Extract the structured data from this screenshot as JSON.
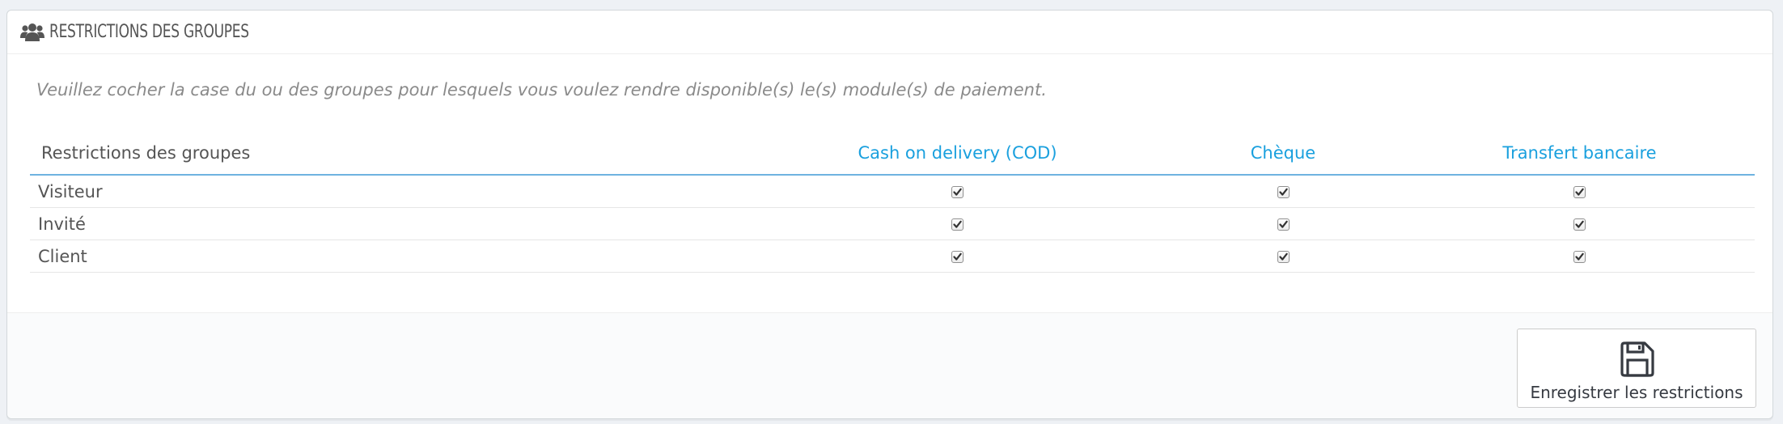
{
  "panel": {
    "title": "RESTRICTIONS DES GROUPES",
    "icon": "users-icon",
    "help_text": "Veuillez cocher la case du ou des groupes pour lesquels vous voulez rendre disponible(s) le(s) module(s) de paiement."
  },
  "table": {
    "header_label": "Restrictions des groupes",
    "modules": [
      "Cash on delivery (COD)",
      "Chèque",
      "Transfert bancaire"
    ],
    "rows": [
      {
        "group": "Visiteur",
        "checked": [
          true,
          true,
          true
        ]
      },
      {
        "group": "Invité",
        "checked": [
          true,
          true,
          true
        ]
      },
      {
        "group": "Client",
        "checked": [
          true,
          true,
          true
        ]
      }
    ]
  },
  "footer": {
    "save_label": "Enregistrer les restrictions",
    "save_icon": "floppy-disk-icon"
  },
  "colors": {
    "accent": "#1aa0de",
    "header_rule": "#6fb3e0",
    "text": "#555555",
    "help_text": "#8a8a8a"
  }
}
